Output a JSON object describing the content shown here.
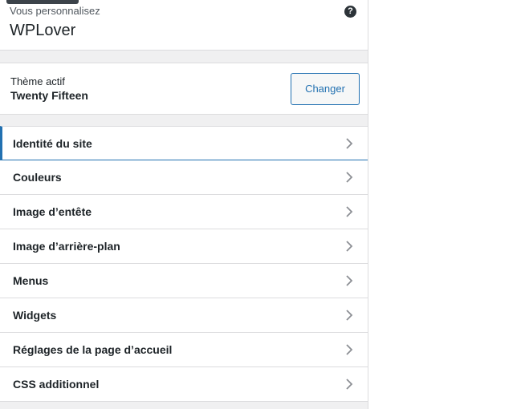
{
  "header": {
    "lead": "Vous personnalisez",
    "site_name": "WPLover",
    "help_icon": "help-icon",
    "help_glyph": "?"
  },
  "theme": {
    "label": "Thème actif",
    "name": "Twenty Fifteen",
    "change_label": "Changer"
  },
  "sections": [
    {
      "label": "Identité du site"
    },
    {
      "label": "Couleurs"
    },
    {
      "label": "Image d’entête"
    },
    {
      "label": "Image d’arrière-plan"
    },
    {
      "label": "Menus"
    },
    {
      "label": "Widgets"
    },
    {
      "label": "Réglages de la page d’accueil"
    },
    {
      "label": "CSS additionnel"
    }
  ],
  "colors": {
    "accent": "#2271b1",
    "text": "#1d2327",
    "panel_bg": "#f0f0f1"
  }
}
